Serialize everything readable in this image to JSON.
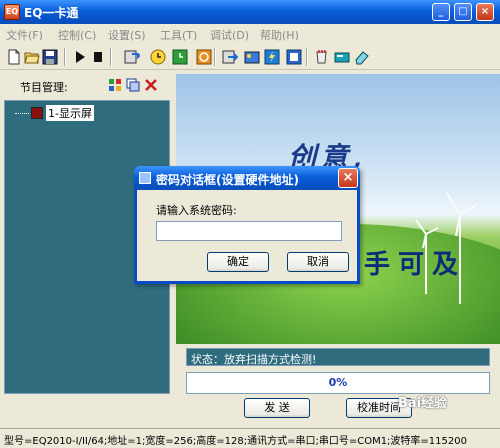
{
  "window": {
    "title": "EQ一卡通",
    "app_icon_text": "EQ",
    "minimize": "_",
    "maximize": "□",
    "close": "×"
  },
  "menu": {
    "items": [
      "文件(F)",
      "控制(C)",
      "设置(S)",
      "工具(T)",
      "调试(D)",
      "帮助(H)"
    ]
  },
  "toolbar": {
    "icons": [
      "new-icon",
      "open-icon",
      "save-icon",
      "play-icon",
      "stop-icon",
      "send-icon",
      "clock-icon",
      "clock-green-icon",
      "power-on-icon",
      "power-off-icon",
      "upload-icon",
      "gallery-icon",
      "flash-icon",
      "cup-icon",
      "card-icon",
      "eraser-icon"
    ]
  },
  "program_panel": {
    "title": "节目管理:",
    "tree": [
      {
        "label": "1-显示屏"
      }
    ]
  },
  "preview": {
    "slogan_top": "创意,",
    "slogan_bottom": "手可及"
  },
  "status": {
    "message": "状态：放弃扫描方式检测!",
    "progress_value": 0,
    "progress_label": "0%"
  },
  "buttons": {
    "send": "发 送",
    "calibrate_time": "校准时间"
  },
  "statusbar": {
    "text": "型号=EQ2010-I/II/64;地址=1;宽度=256;高度=128;通讯方式=串口;串口号=COM1;波特率=115200"
  },
  "dialog": {
    "title": "密码对话框(设置硬件地址)",
    "prompt": "请输入系统密码:",
    "password_value": "",
    "ok": "确定",
    "cancel": "取消",
    "close": "×"
  },
  "watermark": {
    "text": "Bai经验"
  },
  "colors": {
    "xp_title_blue": "#0851c6",
    "panel_teal": "#2e6c7e",
    "progress_text": "#1a3cb5",
    "close_red": "#c2351a"
  }
}
